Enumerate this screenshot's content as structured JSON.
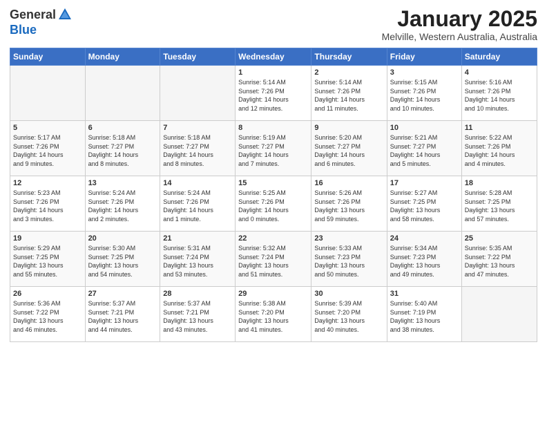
{
  "header": {
    "logo_general": "General",
    "logo_blue": "Blue",
    "month_title": "January 2025",
    "location": "Melville, Western Australia, Australia"
  },
  "weekdays": [
    "Sunday",
    "Monday",
    "Tuesday",
    "Wednesday",
    "Thursday",
    "Friday",
    "Saturday"
  ],
  "weeks": [
    [
      {
        "day": "",
        "info": ""
      },
      {
        "day": "",
        "info": ""
      },
      {
        "day": "",
        "info": ""
      },
      {
        "day": "1",
        "info": "Sunrise: 5:14 AM\nSunset: 7:26 PM\nDaylight: 14 hours\nand 12 minutes."
      },
      {
        "day": "2",
        "info": "Sunrise: 5:14 AM\nSunset: 7:26 PM\nDaylight: 14 hours\nand 11 minutes."
      },
      {
        "day": "3",
        "info": "Sunrise: 5:15 AM\nSunset: 7:26 PM\nDaylight: 14 hours\nand 10 minutes."
      },
      {
        "day": "4",
        "info": "Sunrise: 5:16 AM\nSunset: 7:26 PM\nDaylight: 14 hours\nand 10 minutes."
      }
    ],
    [
      {
        "day": "5",
        "info": "Sunrise: 5:17 AM\nSunset: 7:26 PM\nDaylight: 14 hours\nand 9 minutes."
      },
      {
        "day": "6",
        "info": "Sunrise: 5:18 AM\nSunset: 7:27 PM\nDaylight: 14 hours\nand 8 minutes."
      },
      {
        "day": "7",
        "info": "Sunrise: 5:18 AM\nSunset: 7:27 PM\nDaylight: 14 hours\nand 8 minutes."
      },
      {
        "day": "8",
        "info": "Sunrise: 5:19 AM\nSunset: 7:27 PM\nDaylight: 14 hours\nand 7 minutes."
      },
      {
        "day": "9",
        "info": "Sunrise: 5:20 AM\nSunset: 7:27 PM\nDaylight: 14 hours\nand 6 minutes."
      },
      {
        "day": "10",
        "info": "Sunrise: 5:21 AM\nSunset: 7:27 PM\nDaylight: 14 hours\nand 5 minutes."
      },
      {
        "day": "11",
        "info": "Sunrise: 5:22 AM\nSunset: 7:26 PM\nDaylight: 14 hours\nand 4 minutes."
      }
    ],
    [
      {
        "day": "12",
        "info": "Sunrise: 5:23 AM\nSunset: 7:26 PM\nDaylight: 14 hours\nand 3 minutes."
      },
      {
        "day": "13",
        "info": "Sunrise: 5:24 AM\nSunset: 7:26 PM\nDaylight: 14 hours\nand 2 minutes."
      },
      {
        "day": "14",
        "info": "Sunrise: 5:24 AM\nSunset: 7:26 PM\nDaylight: 14 hours\nand 1 minute."
      },
      {
        "day": "15",
        "info": "Sunrise: 5:25 AM\nSunset: 7:26 PM\nDaylight: 14 hours\nand 0 minutes."
      },
      {
        "day": "16",
        "info": "Sunrise: 5:26 AM\nSunset: 7:26 PM\nDaylight: 13 hours\nand 59 minutes."
      },
      {
        "day": "17",
        "info": "Sunrise: 5:27 AM\nSunset: 7:25 PM\nDaylight: 13 hours\nand 58 minutes."
      },
      {
        "day": "18",
        "info": "Sunrise: 5:28 AM\nSunset: 7:25 PM\nDaylight: 13 hours\nand 57 minutes."
      }
    ],
    [
      {
        "day": "19",
        "info": "Sunrise: 5:29 AM\nSunset: 7:25 PM\nDaylight: 13 hours\nand 55 minutes."
      },
      {
        "day": "20",
        "info": "Sunrise: 5:30 AM\nSunset: 7:25 PM\nDaylight: 13 hours\nand 54 minutes."
      },
      {
        "day": "21",
        "info": "Sunrise: 5:31 AM\nSunset: 7:24 PM\nDaylight: 13 hours\nand 53 minutes."
      },
      {
        "day": "22",
        "info": "Sunrise: 5:32 AM\nSunset: 7:24 PM\nDaylight: 13 hours\nand 51 minutes."
      },
      {
        "day": "23",
        "info": "Sunrise: 5:33 AM\nSunset: 7:23 PM\nDaylight: 13 hours\nand 50 minutes."
      },
      {
        "day": "24",
        "info": "Sunrise: 5:34 AM\nSunset: 7:23 PM\nDaylight: 13 hours\nand 49 minutes."
      },
      {
        "day": "25",
        "info": "Sunrise: 5:35 AM\nSunset: 7:22 PM\nDaylight: 13 hours\nand 47 minutes."
      }
    ],
    [
      {
        "day": "26",
        "info": "Sunrise: 5:36 AM\nSunset: 7:22 PM\nDaylight: 13 hours\nand 46 minutes."
      },
      {
        "day": "27",
        "info": "Sunrise: 5:37 AM\nSunset: 7:21 PM\nDaylight: 13 hours\nand 44 minutes."
      },
      {
        "day": "28",
        "info": "Sunrise: 5:37 AM\nSunset: 7:21 PM\nDaylight: 13 hours\nand 43 minutes."
      },
      {
        "day": "29",
        "info": "Sunrise: 5:38 AM\nSunset: 7:20 PM\nDaylight: 13 hours\nand 41 minutes."
      },
      {
        "day": "30",
        "info": "Sunrise: 5:39 AM\nSunset: 7:20 PM\nDaylight: 13 hours\nand 40 minutes."
      },
      {
        "day": "31",
        "info": "Sunrise: 5:40 AM\nSunset: 7:19 PM\nDaylight: 13 hours\nand 38 minutes."
      },
      {
        "day": "",
        "info": ""
      }
    ]
  ]
}
